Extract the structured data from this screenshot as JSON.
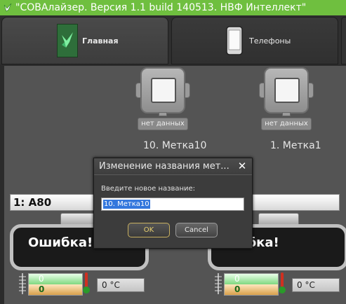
{
  "window": {
    "title": "\"СОВАлайзер. Версия 1.1 build 140513. НВФ Интеллект\""
  },
  "tabs": [
    {
      "label": "Главная",
      "icon": "bird-icon",
      "active": true
    },
    {
      "label": "Телефоны",
      "icon": "phone-icon",
      "active": false
    }
  ],
  "sensors": [
    {
      "status": "нет данных",
      "name": "10. Метка10"
    },
    {
      "status": "нет данных",
      "name": "1. Метка1"
    }
  ],
  "tank_label": "1: А80",
  "tanks": [
    {
      "error": "Ошибка!",
      "level_top": "0",
      "level_bottom": "0",
      "temperature": "0 °C"
    },
    {
      "error": "ибка!",
      "level_top": "0",
      "level_bottom": "0",
      "temperature": "0 °C"
    }
  ],
  "dialog": {
    "title": "Изменение названия мет...",
    "close": "✕",
    "prompt": "Введите новое название:",
    "value": "10. Метка10",
    "ok_label": "OK",
    "cancel_label": "Cancel"
  },
  "colors": {
    "titlebar": "#6fbf3f",
    "panel": "#545454",
    "selection": "#3377dd"
  }
}
